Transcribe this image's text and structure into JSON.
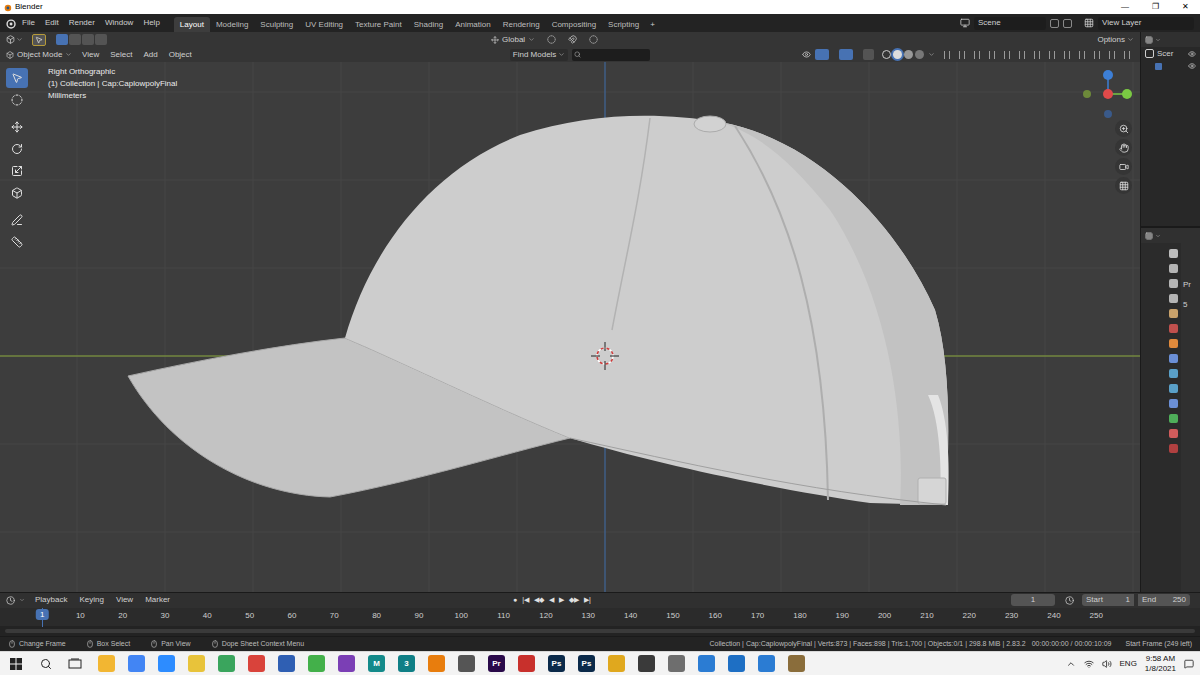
{
  "window": {
    "title": "Blender",
    "controls": [
      "—",
      "❐",
      "✕"
    ]
  },
  "menu": [
    "File",
    "Edit",
    "Render",
    "Window",
    "Help"
  ],
  "workspaces": [
    {
      "label": "Layout",
      "selected": true
    },
    {
      "label": "Modeling",
      "selected": false
    },
    {
      "label": "Sculpting",
      "selected": false
    },
    {
      "label": "UV Editing",
      "selected": false
    },
    {
      "label": "Texture Paint",
      "selected": false
    },
    {
      "label": "Shading",
      "selected": false
    },
    {
      "label": "Animation",
      "selected": false
    },
    {
      "label": "Rendering",
      "selected": false
    },
    {
      "label": "Compositing",
      "selected": false
    },
    {
      "label": "Scripting",
      "selected": false
    }
  ],
  "add_workspace": "+",
  "scene": "Scene",
  "view_layer": "View Layer",
  "tool_header": {
    "orientation": "Global",
    "options": "Options"
  },
  "viewport_header": {
    "mode": "Object Mode",
    "menus": [
      "View",
      "Select",
      "Add",
      "Object"
    ],
    "find": "Find Models",
    "search": ""
  },
  "toolbar": [
    {
      "selected": true
    },
    {
      "selected": false
    },
    {
      "selected": false
    },
    {
      "selected": false
    },
    {
      "selected": false
    },
    {
      "selected": false
    },
    {
      "selected": false
    },
    {
      "selected": false
    }
  ],
  "viewport": {
    "overlay": [
      "Right Orthographic",
      "(1) Collection | Cap:CaplowpolyFinal",
      "Millimeters"
    ]
  },
  "outliner": {
    "items": [
      {
        "label": "Scer",
        "visible": true
      }
    ]
  },
  "properties": {
    "texts": [
      "Pr",
      "5"
    ]
  },
  "timeline": {
    "menus": [
      "Playback",
      "Keying",
      "View",
      "Marker"
    ],
    "transport": [
      "●",
      "|◀",
      "◀◆",
      "◀",
      "▶",
      "◆▶",
      "▶|"
    ],
    "current_frame": "1",
    "start_label": "Start",
    "start": "1",
    "end_label": "End",
    "end": "250",
    "ticks": [
      "10",
      "20",
      "30",
      "40",
      "50",
      "60",
      "70",
      "80",
      "90",
      "100",
      "110",
      "120",
      "130",
      "140",
      "150",
      "160",
      "170",
      "180",
      "190",
      "200",
      "210",
      "220",
      "230",
      "240",
      "250"
    ]
  },
  "status_bar": {
    "hints": [
      "Change Frame",
      "Box Select",
      "Pan View",
      "Dope Sheet Context Menu"
    ],
    "stats": "Collection | Cap:CaplowpolyFinal | Verts:873 | Faces:898 | Tris:1,700 | Objects:0/1 | 298.8 MiB | 2.83.2",
    "time": "00:00:00:00 / 00:00:10:09",
    "frame_info": "Start Frame (249 left)"
  },
  "taskbar": {
    "apps": [
      {
        "label": "",
        "color": "#f2b632"
      },
      {
        "label": "",
        "color": "#4285f4"
      },
      {
        "label": "",
        "color": "#2d8cff"
      },
      {
        "label": "",
        "color": "#e8c33a"
      },
      {
        "label": "",
        "color": "#3aa55d"
      },
      {
        "label": "",
        "color": "#d9433b"
      },
      {
        "label": "",
        "color": "#2f5fb3"
      },
      {
        "label": "",
        "color": "#43b04a"
      },
      {
        "label": "",
        "color": "#7b3fb5"
      },
      {
        "label": "M",
        "color": "#138a8a"
      },
      {
        "label": "3",
        "color": "#0f7f86"
      },
      {
        "label": "",
        "color": "#e87d0d"
      },
      {
        "label": "",
        "color": "#555555"
      },
      {
        "label": "Pr",
        "color": "#2a0a4a"
      },
      {
        "label": "",
        "color": "#c8302c"
      },
      {
        "label": "Ps",
        "color": "#0b2a4a"
      },
      {
        "label": "Ps",
        "color": "#0b2a4a"
      },
      {
        "label": "",
        "color": "#e0a81e"
      },
      {
        "label": "",
        "color": "#3a3a3a"
      },
      {
        "label": "",
        "color": "#6e6e6e"
      },
      {
        "label": "",
        "color": "#2b7cd3"
      },
      {
        "label": "",
        "color": "#1e6fc4"
      },
      {
        "label": "",
        "color": "#2b7cd3"
      },
      {
        "label": "",
        "color": "#8a6d3b"
      }
    ],
    "language": "ENG",
    "time": "9:58 AM",
    "date": "1/8/2021"
  }
}
